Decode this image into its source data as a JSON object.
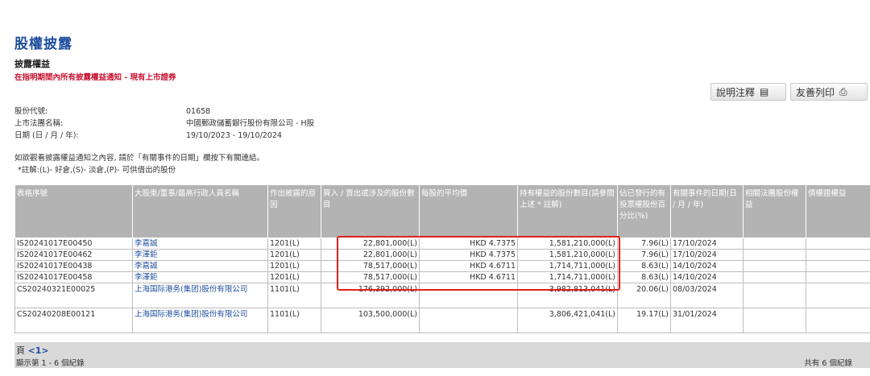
{
  "page": {
    "title": "股權披露",
    "subtitle": "披露權益",
    "notice": "在指明期間內所有披露權益通知 - 現有上市證券"
  },
  "toolbar": {
    "notes_label": "說明注釋",
    "notes_icon": "document-icon",
    "print_label": "友善列印",
    "print_icon": "printer-icon"
  },
  "info": {
    "stock_code_label": "股份代號:",
    "stock_code": "01658",
    "company_label": "上市法團名稱:",
    "company": "中國郵政儲蓄銀行股份有限公司 - H股",
    "date_label": "日期 (日 / 月 / 年):",
    "date_range": "19/10/2023 - 19/10/2024"
  },
  "notes": {
    "line1": "如欲觀看披露權益通知之內容, 請於「有關事件的日期」欄按下有關連結。",
    "line2": "*註解:(L)- 好倉,(S)- 淡倉,(P)- 可供借出的股份"
  },
  "table": {
    "headers": [
      "表格序號",
      "大股東/董事/最高行政人員名稱",
      "作出披露的原因",
      "買入 / 賣出或涉及的股份數目",
      "每股的平均價",
      "持有權益的股份數目(請參閱上述 * 註解)",
      "佔已發行的有投票權股份百分比(%)",
      "有關事件的日期(日 / 月 / 年)",
      "相關法團股份權益",
      "債權證權益"
    ],
    "rows": [
      {
        "form": "IS20241017E00450",
        "name": "李嘉誠",
        "reason": "1201(L)",
        "shares": "22,801,000(L)",
        "price": "HKD 4.7375",
        "holding": "1,581,210,000(L)",
        "pct": "7.96(L)",
        "date": "17/10/2024"
      },
      {
        "form": "IS20241017E00462",
        "name": "李澤鉅",
        "reason": "1201(L)",
        "shares": "22,801,000(L)",
        "price": "HKD 4.7375",
        "holding": "1,581,210,000(L)",
        "pct": "7.96(L)",
        "date": "17/10/2024"
      },
      {
        "form": "IS20241017E00438",
        "name": "李嘉誠",
        "reason": "1201(L)",
        "shares": "78,517,000(L)",
        "price": "HKD 4.6711",
        "holding": "1,714,711,000(L)",
        "pct": "8.63(L)",
        "date": "14/10/2024"
      },
      {
        "form": "IS20241017E00458",
        "name": "李澤鉅",
        "reason": "1201(L)",
        "shares": "78,517,000(L)",
        "price": "HKD 4.6711",
        "holding": "1,714,711,000(L)",
        "pct": "8.63(L)",
        "date": "14/10/2024"
      },
      {
        "form": "CS20240321E00025",
        "name": "上海国际港务(集团)股份有限公司",
        "reason": "1101(L)",
        "shares": "176,392,000(L)",
        "price": "",
        "holding": "3,982,813,041(L)",
        "pct": "20.06(L)",
        "date": "08/03/2024"
      },
      {
        "form": "CS20240208E00121",
        "name": "上海国际港务(集团)股份有限公司",
        "reason": "1101(L)",
        "shares": "103,500,000(L)",
        "price": "",
        "holding": "3,806,421,041(L)",
        "pct": "19.17(L)",
        "date": "31/01/2024"
      }
    ]
  },
  "footer": {
    "page_prefix": "頁",
    "page_current": "<1>",
    "range_text": "顯示第 1 - 6 個紀錄",
    "total_text": "共有 6 個紀錄"
  },
  "colors": {
    "title_blue": "#1f4e9c",
    "notice_red": "#c8102e",
    "header_gray": "#b3b3b3",
    "highlight_red": "#e0201b"
  }
}
